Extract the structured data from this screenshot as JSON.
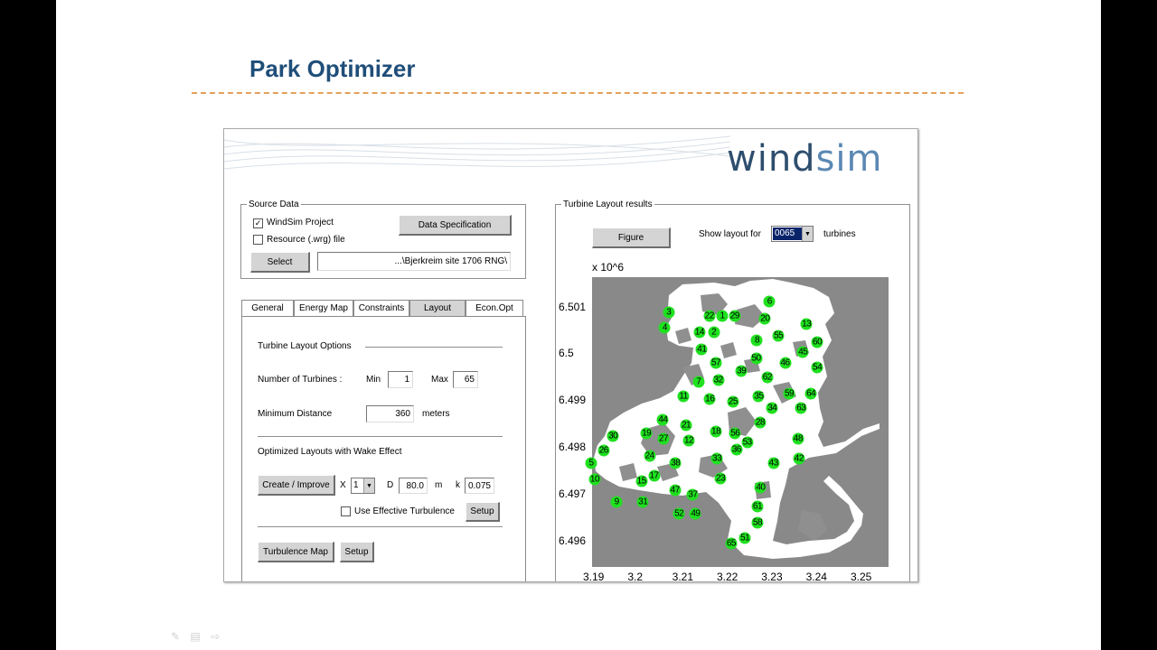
{
  "slide": {
    "title": "Park Optimizer",
    "accent_color": "#1f4e79",
    "dash_color": "#e4a15a"
  },
  "app": {
    "logo": {
      "part1": "wi",
      "part2": "nd",
      "part3": "sim"
    },
    "source_data": {
      "legend": "Source Data",
      "windsim_project": {
        "label": "WindSim Project",
        "checked": true
      },
      "resource_file": {
        "label": "Resource (.wrg) file",
        "checked": false
      },
      "data_spec_button": "Data Specification",
      "select_button": "Select",
      "path_value": "...\\Bjerkreim site 1706 RNG\\"
    },
    "tabs": [
      "General",
      "Energy Map",
      "Constraints",
      "Layout",
      "Econ.Opt"
    ],
    "active_tab": "Layout",
    "layout_panel": {
      "options_heading": "Turbine Layout Options",
      "num_turbines_label": "Number of Turbines :",
      "min_label": "Min",
      "min_value": "1",
      "max_label": "Max",
      "max_value": "65",
      "min_distance_label": "Minimum Distance",
      "min_distance_value": "360",
      "min_distance_unit": "meters",
      "wake_heading": "Optimized Layouts with Wake Effect",
      "create_button": "Create / Improve",
      "x_label": "X",
      "x_value": "1",
      "d_label": "D",
      "d_value": "80.0",
      "m_label": "m",
      "k_label": "k",
      "k_value": "0.075",
      "effective_turbulence": {
        "label": "Use Effective Turbulence",
        "checked": false
      },
      "setup_button": "Setup",
      "turbulence_map_button": "Turbulence Map",
      "setup2_button": "Setup"
    },
    "results": {
      "legend": "Turbine Layout results",
      "figure_button": "Figure",
      "show_layout_label": "Show layout for",
      "show_layout_value": "0065",
      "turbines_label": "turbines"
    }
  },
  "chart_data": {
    "type": "scatter",
    "title": "",
    "xlabel": "",
    "ylabel": "",
    "y_multiplier": "x 10^6",
    "x_ticks": [
      "3.19",
      "3.2",
      "3.21",
      "3.22",
      "3.23",
      "3.24",
      "3.25"
    ],
    "y_ticks": [
      "6.501",
      "6.5",
      "6.499",
      "6.498",
      "6.497",
      "6.496"
    ],
    "xlim": [
      3.19,
      3.2565
    ],
    "ylim": [
      6.49545,
      6.50165
    ],
    "point_color": "#1fe11f",
    "points": [
      {
        "label": "1",
        "x": 3.2192,
        "y": 6.50081
      },
      {
        "label": "2",
        "x": 3.2173,
        "y": 6.50047
      },
      {
        "label": "3",
        "x": 3.2072,
        "y": 6.50089
      },
      {
        "label": "4",
        "x": 3.2063,
        "y": 6.50056
      },
      {
        "label": "5",
        "x": 3.1898,
        "y": 6.49767
      },
      {
        "label": "6",
        "x": 3.2298,
        "y": 6.50112
      },
      {
        "label": "7",
        "x": 3.2139,
        "y": 6.49941
      },
      {
        "label": "8",
        "x": 3.227,
        "y": 6.50029
      },
      {
        "label": "9",
        "x": 3.1955,
        "y": 6.49684
      },
      {
        "label": "10",
        "x": 3.1906,
        "y": 6.49733
      },
      {
        "label": "11",
        "x": 3.2105,
        "y": 6.4991
      },
      {
        "label": "12",
        "x": 3.2117,
        "y": 6.49815
      },
      {
        "label": "13",
        "x": 3.2381,
        "y": 6.50065
      },
      {
        "label": "14",
        "x": 3.2141,
        "y": 6.50047
      },
      {
        "label": "15",
        "x": 3.2011,
        "y": 6.49728
      },
      {
        "label": "16",
        "x": 3.2164,
        "y": 6.49905
      },
      {
        "label": "17",
        "x": 3.2039,
        "y": 6.4974
      },
      {
        "label": "18",
        "x": 3.2178,
        "y": 6.49835
      },
      {
        "label": "19",
        "x": 3.2022,
        "y": 6.4983
      },
      {
        "label": "20",
        "x": 3.2288,
        "y": 6.50076
      },
      {
        "label": "21",
        "x": 3.2111,
        "y": 6.49849
      },
      {
        "label": "22",
        "x": 3.2163,
        "y": 6.50081
      },
      {
        "label": "23",
        "x": 3.2188,
        "y": 6.49735
      },
      {
        "label": "24",
        "x": 3.2029,
        "y": 6.49783
      },
      {
        "label": "25",
        "x": 3.2216,
        "y": 6.49899
      },
      {
        "label": "26",
        "x": 3.1926,
        "y": 6.49795
      },
      {
        "label": "27",
        "x": 3.206,
        "y": 6.4982
      },
      {
        "label": "28",
        "x": 3.2277,
        "y": 6.49854
      },
      {
        "label": "29",
        "x": 3.222,
        "y": 6.50081
      },
      {
        "label": "30",
        "x": 3.1947,
        "y": 6.49825
      },
      {
        "label": "31",
        "x": 3.2014,
        "y": 6.49684
      },
      {
        "label": "32",
        "x": 3.2183,
        "y": 6.49945
      },
      {
        "label": "33",
        "x": 3.218,
        "y": 6.49777
      },
      {
        "label": "34",
        "x": 3.2304,
        "y": 6.49885
      },
      {
        "label": "35",
        "x": 3.2274,
        "y": 6.4991
      },
      {
        "label": "36",
        "x": 3.2224,
        "y": 6.49796
      },
      {
        "label": "37",
        "x": 3.2126,
        "y": 6.49699
      },
      {
        "label": "38",
        "x": 3.2087,
        "y": 6.49767
      },
      {
        "label": "39",
        "x": 3.2235,
        "y": 6.49964
      },
      {
        "label": "40",
        "x": 3.2278,
        "y": 6.49715
      },
      {
        "label": "41",
        "x": 3.2146,
        "y": 6.5001
      },
      {
        "label": "42",
        "x": 3.2364,
        "y": 6.49777
      },
      {
        "label": "43",
        "x": 3.2307,
        "y": 6.49767
      },
      {
        "label": "44",
        "x": 3.2059,
        "y": 6.4986
      },
      {
        "label": "45",
        "x": 3.2373,
        "y": 6.50005
      },
      {
        "label": "46",
        "x": 3.2333,
        "y": 6.49981
      },
      {
        "label": "47",
        "x": 3.2086,
        "y": 6.49709
      },
      {
        "label": "48",
        "x": 3.2362,
        "y": 6.4982
      },
      {
        "label": "49",
        "x": 3.2132,
        "y": 6.49659
      },
      {
        "label": "50",
        "x": 3.2268,
        "y": 6.49991
      },
      {
        "label": "51",
        "x": 3.2243,
        "y": 6.49606
      },
      {
        "label": "52",
        "x": 3.2095,
        "y": 6.49659
      },
      {
        "label": "53",
        "x": 3.2248,
        "y": 6.49811
      },
      {
        "label": "54",
        "x": 3.2405,
        "y": 6.49971
      },
      {
        "label": "55",
        "x": 3.2318,
        "y": 6.5004
      },
      {
        "label": "56",
        "x": 3.2221,
        "y": 6.4983
      },
      {
        "label": "57",
        "x": 3.2178,
        "y": 6.49981
      },
      {
        "label": "58",
        "x": 3.2271,
        "y": 6.4964
      },
      {
        "label": "59",
        "x": 3.2342,
        "y": 6.49915
      },
      {
        "label": "60",
        "x": 3.2405,
        "y": 6.50025
      },
      {
        "label": "61",
        "x": 3.2271,
        "y": 6.49674
      },
      {
        "label": "62",
        "x": 3.2293,
        "y": 6.4995
      },
      {
        "label": "63",
        "x": 3.2369,
        "y": 6.49885
      },
      {
        "label": "64",
        "x": 3.2391,
        "y": 6.49915
      },
      {
        "label": "65",
        "x": 3.2212,
        "y": 6.49596
      }
    ]
  }
}
